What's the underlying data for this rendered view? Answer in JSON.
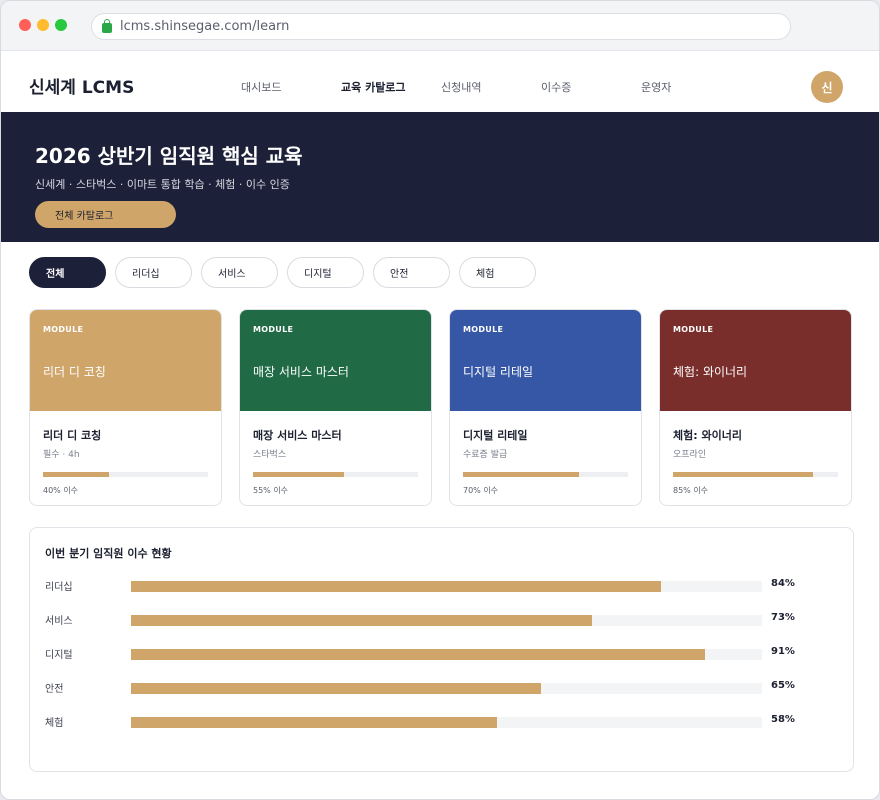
{
  "browser": {
    "url": "lcms.shinsegae.com/learn"
  },
  "nav": {
    "logo": "신세계 LCMS",
    "items": [
      {
        "label": "대시보드",
        "active": false
      },
      {
        "label": "교육 카탈로그",
        "active": true
      },
      {
        "label": "신청내역",
        "active": false
      },
      {
        "label": "이수증",
        "active": false
      },
      {
        "label": "운영자",
        "active": false
      }
    ],
    "avatar": "신"
  },
  "hero": {
    "title": "2026 상반기 임직원 핵심 교육",
    "subtitle": "신세계 · 스타벅스 · 이마트 통합 학습 · 체험 · 이수 인증",
    "button": "전체 카탈로그"
  },
  "filters": [
    {
      "label": "전체",
      "active": true
    },
    {
      "label": "리더십",
      "active": false
    },
    {
      "label": "서비스",
      "active": false
    },
    {
      "label": "디지털",
      "active": false
    },
    {
      "label": "안전",
      "active": false
    },
    {
      "label": "체험",
      "active": false
    }
  ],
  "cards": [
    {
      "module": "MODULE",
      "head_title": "리더 디 코칭",
      "title": "리더 디 코칭",
      "meta": "필수 · 4h",
      "progress": 0.4,
      "progress_text": "40% 이수",
      "color": "#d0a56a"
    },
    {
      "module": "MODULE",
      "head_title": "매장 서비스 마스터",
      "title": "매장 서비스 마스터",
      "meta": "스타벅스",
      "progress": 0.55,
      "progress_text": "55% 이수",
      "color": "#206b45"
    },
    {
      "module": "MODULE",
      "head_title": "디지털 리테일",
      "title": "디지털 리테일",
      "meta": "수료증 발급",
      "progress": 0.7,
      "progress_text": "70% 이수",
      "color": "#3657a6"
    },
    {
      "module": "MODULE",
      "head_title": "체험: 와이너리",
      "title": "체험: 와이너리",
      "meta": "오프라인",
      "progress": 0.85,
      "progress_text": "85% 이수",
      "color": "#7a2e2c"
    }
  ],
  "stats": {
    "title": "이번 분기 임직원 이수 현황",
    "rows": [
      {
        "label": "리더십",
        "value": 84,
        "value_text": "84%"
      },
      {
        "label": "서비스",
        "value": 73,
        "value_text": "73%"
      },
      {
        "label": "디지털",
        "value": 91,
        "value_text": "91%"
      },
      {
        "label": "안전",
        "value": 65,
        "value_text": "65%"
      },
      {
        "label": "체험",
        "value": 58,
        "value_text": "58%"
      }
    ]
  }
}
